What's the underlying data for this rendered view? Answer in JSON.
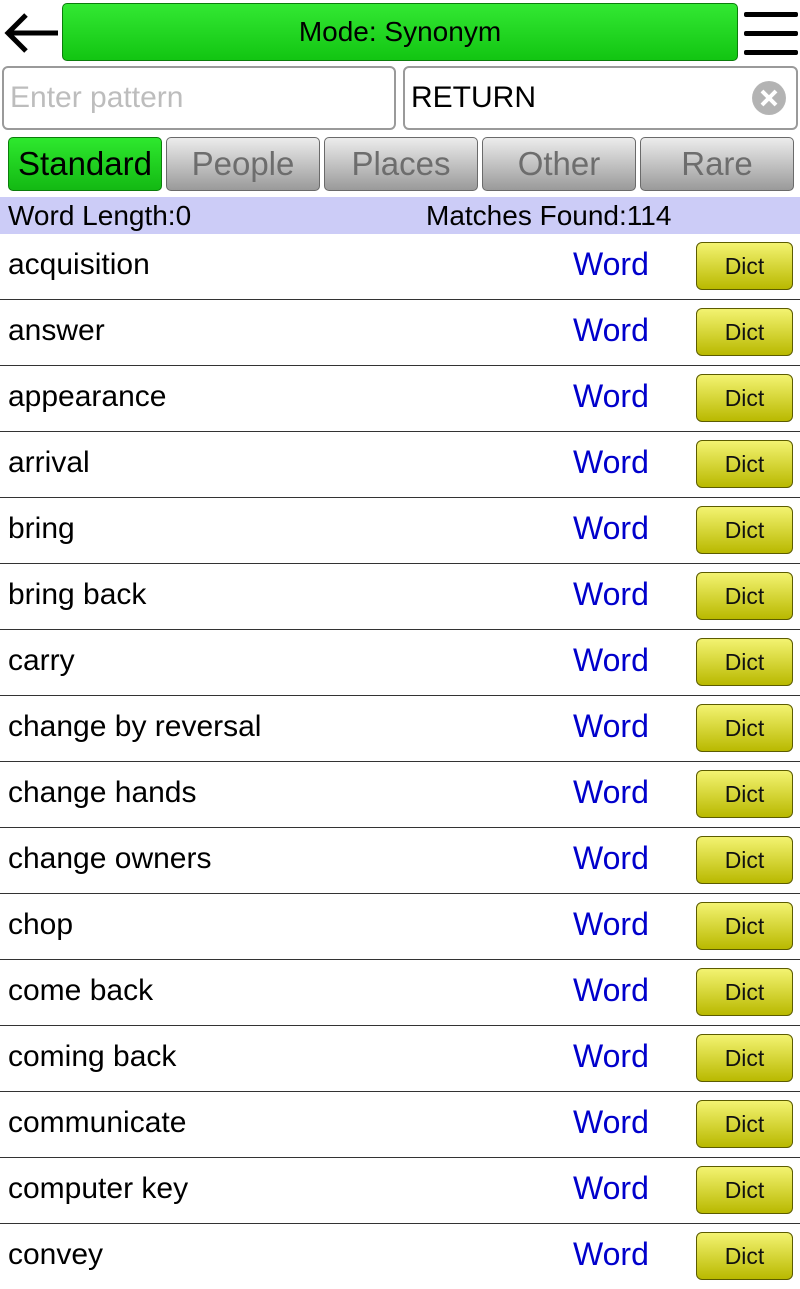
{
  "header": {
    "mode_label": "Mode: Synonym"
  },
  "search": {
    "pattern_placeholder": "Enter pattern",
    "pattern_value": "",
    "word_value": "RETURN"
  },
  "tabs": [
    {
      "label": "Standard",
      "active": true
    },
    {
      "label": "People",
      "active": false
    },
    {
      "label": "Places",
      "active": false
    },
    {
      "label": "Other",
      "active": false
    },
    {
      "label": "Rare",
      "active": false
    }
  ],
  "status": {
    "word_length": "Word Length:0",
    "matches": "Matches Found:114"
  },
  "results": [
    {
      "word": "acquisition",
      "type": "Word",
      "action": "Dict"
    },
    {
      "word": "answer",
      "type": "Word",
      "action": "Dict"
    },
    {
      "word": "appearance",
      "type": "Word",
      "action": "Dict"
    },
    {
      "word": "arrival",
      "type": "Word",
      "action": "Dict"
    },
    {
      "word": "bring",
      "type": "Word",
      "action": "Dict"
    },
    {
      "word": "bring back",
      "type": "Word",
      "action": "Dict"
    },
    {
      "word": "carry",
      "type": "Word",
      "action": "Dict"
    },
    {
      "word": "change by reversal",
      "type": "Word",
      "action": "Dict"
    },
    {
      "word": "change hands",
      "type": "Word",
      "action": "Dict"
    },
    {
      "word": "change owners",
      "type": "Word",
      "action": "Dict"
    },
    {
      "word": "chop",
      "type": "Word",
      "action": "Dict"
    },
    {
      "word": "come back",
      "type": "Word",
      "action": "Dict"
    },
    {
      "word": "coming back",
      "type": "Word",
      "action": "Dict"
    },
    {
      "word": "communicate",
      "type": "Word",
      "action": "Dict"
    },
    {
      "word": "computer key",
      "type": "Word",
      "action": "Dict"
    },
    {
      "word": "convey",
      "type": "Word",
      "action": "Dict"
    }
  ],
  "icons": {
    "back": "arrow-left-icon",
    "menu": "hamburger-menu-icon",
    "clear": "clear-x-icon"
  },
  "colors": {
    "accent_green": "#22d322",
    "status_bg": "#ccccf7",
    "word_type_blue": "#0000cc",
    "dict_yellow": "#d6d61e"
  }
}
